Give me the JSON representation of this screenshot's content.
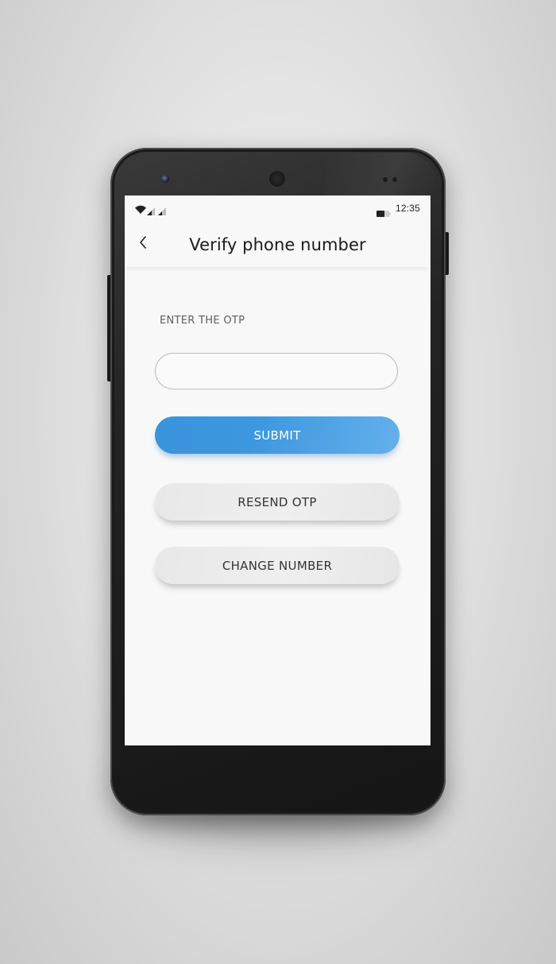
{
  "status_bar": {
    "time": "12:35",
    "wifi_icon": "wifi-icon",
    "signal_icons": [
      "signal-icon",
      "signal-icon"
    ],
    "battery_icon": "battery-icon"
  },
  "app_bar": {
    "back_icon": "chevron-left-icon",
    "title": "Verify phone number"
  },
  "form": {
    "otp_label": "ENTER THE OTP",
    "otp_value": "",
    "submit_label": "SUBMIT",
    "resend_label": "RESEND OTP",
    "change_number_label": "CHANGE NUMBER"
  },
  "colors": {
    "primary": "#3a93dc",
    "secondary_button": "#ececec",
    "screen_background": "#f8f8f8"
  }
}
